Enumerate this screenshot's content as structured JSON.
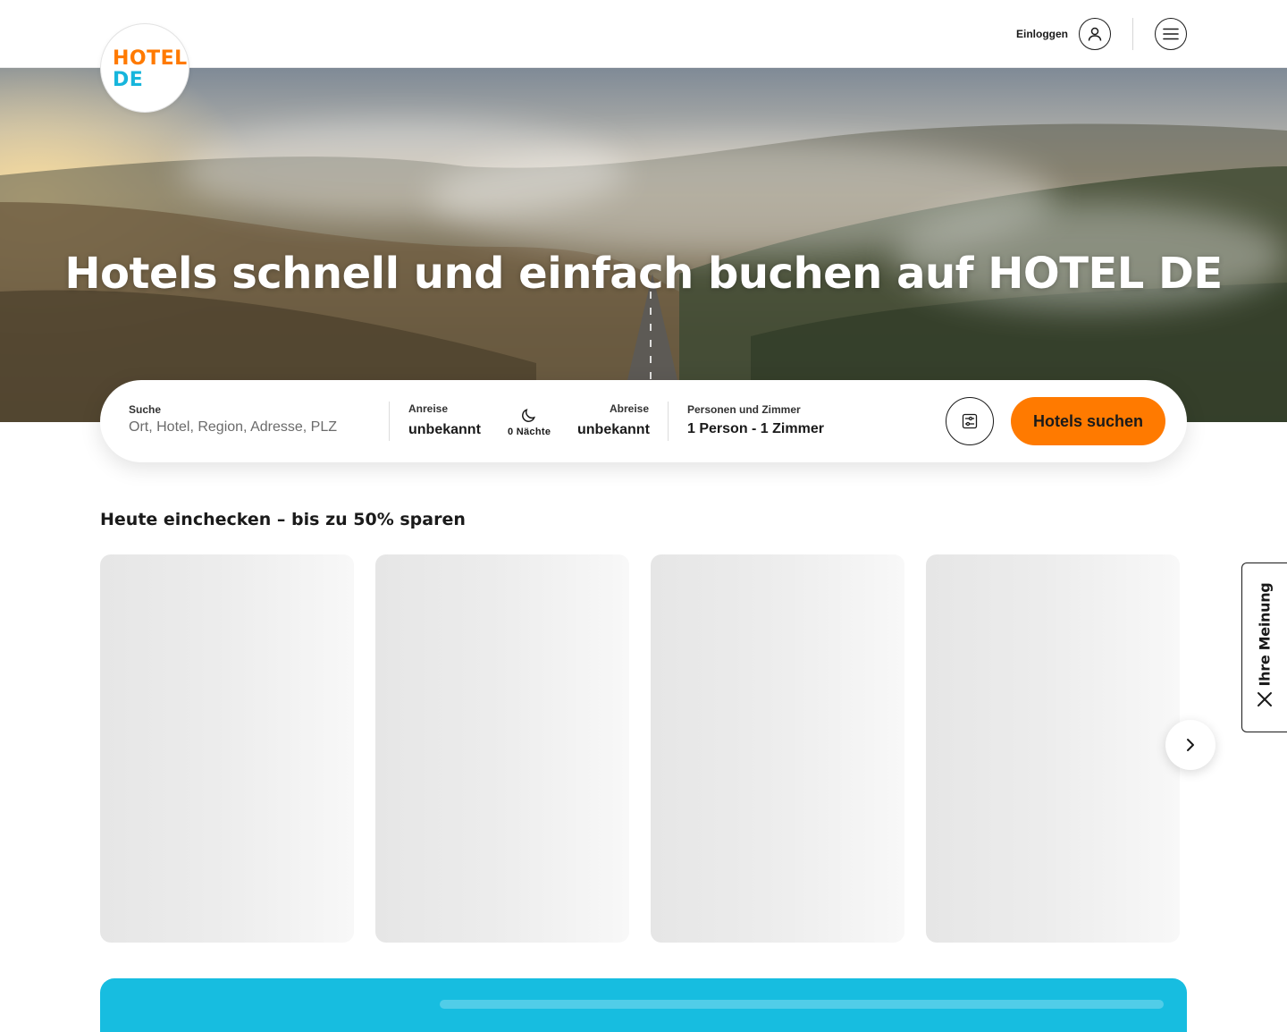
{
  "header": {
    "logo": {
      "line1": "HOTEL",
      "line2": "DE"
    },
    "login_label": "Einloggen",
    "icons": {
      "user": "user-icon",
      "menu": "hamburger-menu-icon"
    }
  },
  "hero": {
    "title": "Hotels schnell und einfach buchen auf HOTEL DE"
  },
  "search": {
    "search_label": "Suche",
    "search_placeholder": "Ort, Hotel, Region, Adresse, PLZ",
    "checkin_label": "Anreise",
    "checkin_value": "unbekannt",
    "nights_label": "0 Nächte",
    "checkout_label": "Abreise",
    "checkout_value": "unbekannt",
    "guests_label": "Personen und Zimmer",
    "guests_value": "1 Person - 1 Zimmer",
    "submit_label": "Hotels suchen",
    "icons": {
      "nights": "moon-icon",
      "filter": "filter-settings-icon"
    }
  },
  "deals": {
    "title": "Heute einchecken – bis zu 50% sparen",
    "next_icon": "chevron-right-icon"
  },
  "feedback": {
    "label": "Ihre Meinung",
    "close_icon": "close-icon"
  },
  "colors": {
    "brand_orange": "#ff7a00",
    "brand_blue": "#16b5dc",
    "banner_blue": "#17bde0"
  }
}
